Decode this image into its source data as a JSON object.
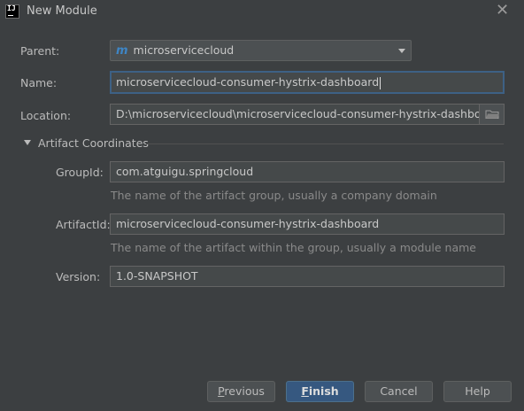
{
  "window": {
    "title": "New Module",
    "app_icon_text": "IJ"
  },
  "form": {
    "parent": {
      "label": "Parent:",
      "value": "microservicecloud",
      "icon": "maven-m-icon"
    },
    "name": {
      "label": "Name:",
      "value": "microservicecloud-consumer-hystrix-dashboard"
    },
    "location": {
      "label": "Location:",
      "value": "D:\\microservicecloud\\microservicecloud-consumer-hystrix-dashboard"
    },
    "section": {
      "title": "Artifact Coordinates"
    },
    "group_id": {
      "label": "GroupId:",
      "value": "com.atguigu.springcloud",
      "hint": "The name of the artifact group, usually a company domain"
    },
    "artifact_id": {
      "label": "ArtifactId:",
      "value": "microservicecloud-consumer-hystrix-dashboard",
      "hint": "The name of the artifact within the group, usually a module name"
    },
    "version": {
      "label": "Version:",
      "value": "1.0-SNAPSHOT"
    }
  },
  "buttons": {
    "previous_first": "P",
    "previous_rest": "revious",
    "finish_first": "F",
    "finish_rest": "inish",
    "cancel": "Cancel",
    "help": "Help"
  },
  "colors": {
    "background": "#3c3f41",
    "field": "#45494a",
    "accent": "#365880",
    "maven_icon": "#3e86c6"
  }
}
